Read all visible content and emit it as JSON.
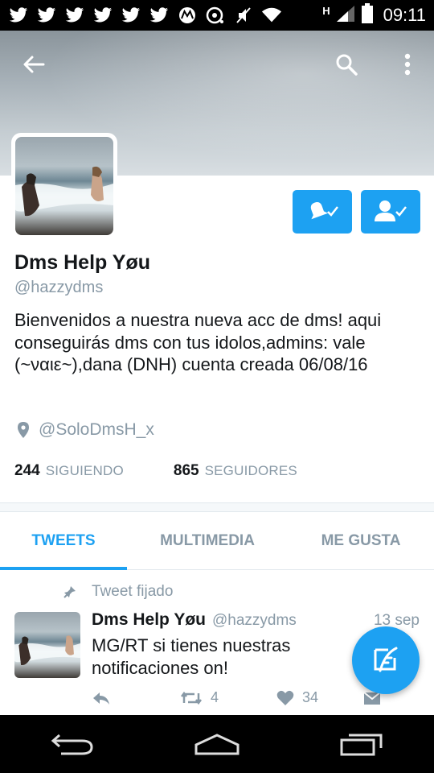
{
  "status_bar": {
    "time": "09:11",
    "notification_icons": [
      "twitter-icon",
      "twitter-icon",
      "twitter-icon",
      "twitter-icon",
      "twitter-icon",
      "twitter-icon",
      "motorola-icon",
      "sync-icon",
      "mute-icon",
      "wifi-icon"
    ],
    "network_label": "H"
  },
  "profile": {
    "name": "Dms Help Yøu",
    "handle": "@hazzydms",
    "bio": "Bienvenidos a nuestra nueva acc de dms! aqui conseguirás dms con tus idolos,admins: vale (~ναιε~),dana (DNH) cuenta creada 06/08/16",
    "location": "@SoloDmsH_x",
    "following_count": "244",
    "following_label": "SIGUIENDO",
    "followers_count": "865",
    "followers_label": "SEGUIDORES"
  },
  "tabs": [
    {
      "label": "TWEETS",
      "active": true
    },
    {
      "label": "MULTIMEDIA",
      "active": false
    },
    {
      "label": "ME GUSTA",
      "active": false
    }
  ],
  "pinned_label": "Tweet fijado",
  "tweet": {
    "name": "Dms Help Yøu",
    "handle": "@hazzydms",
    "date": "13 sep",
    "text": "MG/RT si tienes nuestras notificaciones on!",
    "retweets": "4",
    "likes": "34"
  },
  "colors": {
    "accent": "#1da1f2",
    "secondary_text": "#8899a6",
    "primary_text": "#14171a"
  }
}
